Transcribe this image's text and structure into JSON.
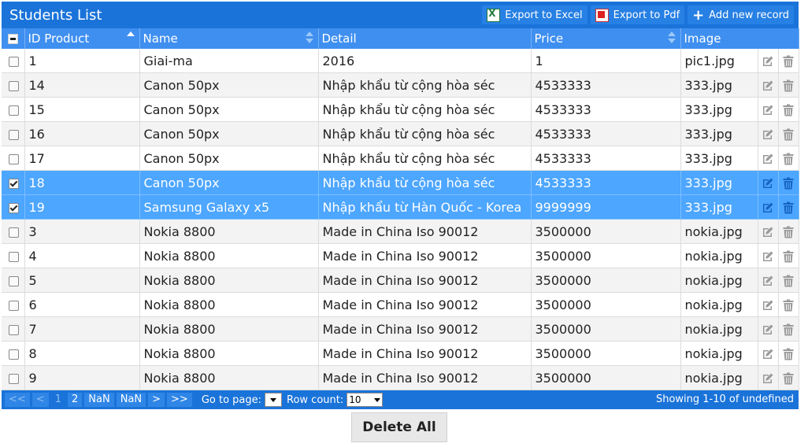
{
  "title": "Students List",
  "toolbar": {
    "export_excel": "Export to Excel",
    "export_pdf": "Export to Pdf",
    "add_new": "Add new record"
  },
  "columns": [
    "ID Product",
    "Name",
    "Detail",
    "Price",
    "Image"
  ],
  "rows": [
    {
      "id": "1",
      "name": "Giai-ma",
      "detail": "2016",
      "price": "1",
      "image": "pic1.jpg",
      "selected": false
    },
    {
      "id": "14",
      "name": "Canon 50px",
      "detail": "Nhập khẩu từ cộng hòa séc",
      "price": "4533333",
      "image": "333.jpg",
      "selected": false
    },
    {
      "id": "15",
      "name": "Canon 50px",
      "detail": "Nhập khẩu từ cộng hòa séc",
      "price": "4533333",
      "image": "333.jpg",
      "selected": false
    },
    {
      "id": "16",
      "name": "Canon 50px",
      "detail": "Nhập khẩu từ cộng hòa séc",
      "price": "4533333",
      "image": "333.jpg",
      "selected": false
    },
    {
      "id": "17",
      "name": "Canon 50px",
      "detail": "Nhập khẩu từ cộng hòa séc",
      "price": "4533333",
      "image": "333.jpg",
      "selected": false
    },
    {
      "id": "18",
      "name": "Canon 50px",
      "detail": "Nhập khẩu từ cộng hòa séc",
      "price": "4533333",
      "image": "333.jpg",
      "selected": true
    },
    {
      "id": "19",
      "name": "Samsung Galaxy x5",
      "detail": "Nhập khẩu từ Hàn Quốc - Korea",
      "price": "9999999",
      "image": "333.jpg",
      "selected": true
    },
    {
      "id": "3",
      "name": "Nokia 8800",
      "detail": "Made in China Iso 90012",
      "price": "3500000",
      "image": "nokia.jpg",
      "selected": false
    },
    {
      "id": "4",
      "name": "Nokia 8800",
      "detail": "Made in China Iso 90012",
      "price": "3500000",
      "image": "nokia.jpg",
      "selected": false
    },
    {
      "id": "5",
      "name": "Nokia 8800",
      "detail": "Made in China Iso 90012",
      "price": "3500000",
      "image": "nokia.jpg",
      "selected": false
    },
    {
      "id": "6",
      "name": "Nokia 8800",
      "detail": "Made in China Iso 90012",
      "price": "3500000",
      "image": "nokia.jpg",
      "selected": false
    },
    {
      "id": "7",
      "name": "Nokia 8800",
      "detail": "Made in China Iso 90012",
      "price": "3500000",
      "image": "nokia.jpg",
      "selected": false
    },
    {
      "id": "8",
      "name": "Nokia 8800",
      "detail": "Made in China Iso 90012",
      "price": "3500000",
      "image": "nokia.jpg",
      "selected": false
    },
    {
      "id": "9",
      "name": "Nokia 8800",
      "detail": "Made in China Iso 90012",
      "price": "3500000",
      "image": "nokia.jpg",
      "selected": false
    }
  ],
  "pager": {
    "first": "<<",
    "prev": "<",
    "pages": [
      "1",
      "2",
      "NaN",
      "NaN"
    ],
    "next": ">",
    "last": ">>",
    "goto_label": "Go to page:",
    "rowcount_label": "Row count:",
    "rowcount_value": "10",
    "showing": "Showing 1-10 of undefined"
  },
  "delete_all": "Delete All"
}
